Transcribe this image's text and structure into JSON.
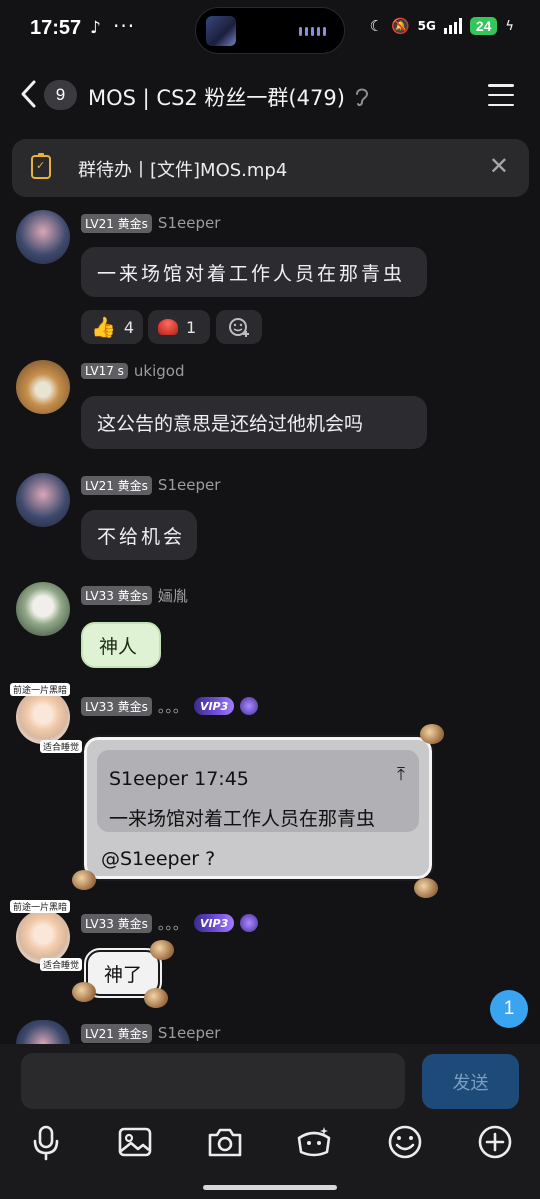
{
  "status_bar": {
    "time": "17:57",
    "network": "5G",
    "battery": "24"
  },
  "header": {
    "unread_count": "9",
    "title": "MOS | CS2 粉丝一群(479)"
  },
  "todo_banner": {
    "text": "群待办丨[文件]MOS.mp4"
  },
  "messages": [
    {
      "level": "LV21 黄金s",
      "name": "S1eeper",
      "text": "一来场馆对着工作人员在那青虫",
      "reactions": [
        {
          "icon": "thumbs-up",
          "count": "4"
        },
        {
          "icon": "red-button",
          "count": "1"
        }
      ]
    },
    {
      "level": "LV17 s",
      "name": "ukigod",
      "text": "这公告的意思是还给过他机会吗"
    },
    {
      "level": "LV21 黄金s",
      "name": "S1eeper",
      "text": "不给机会"
    },
    {
      "level": "LV33 黄金s",
      "name": "婳胤",
      "text": "神人"
    },
    {
      "level": "LV33 黄金s",
      "name": "。。。",
      "vip": "VIP3",
      "quote": {
        "header": "S1eeper 17:45",
        "text": "一来场馆对着工作人员在那青虫"
      },
      "text": "@S1eeper ?"
    },
    {
      "level": "LV33 黄金s",
      "name": "。。。",
      "vip": "VIP3",
      "text": "神了"
    },
    {
      "level": "LV21 黄金s",
      "name": "S1eeper"
    }
  ],
  "avatar_captions": {
    "top": "前途一片黑暗",
    "bottom": "适合睡觉"
  },
  "unread_float": "1",
  "composer": {
    "placeholder": "",
    "send_label": "发送"
  },
  "toolbar_icons": [
    "microphone-icon",
    "image-icon",
    "camera-icon",
    "sticker-icon",
    "emoji-icon",
    "plus-icon"
  ],
  "colors": {
    "background": "#131315",
    "bubble": "#2c2c30",
    "accent": "#3aa4f1",
    "send_button": "#1d4a78"
  }
}
